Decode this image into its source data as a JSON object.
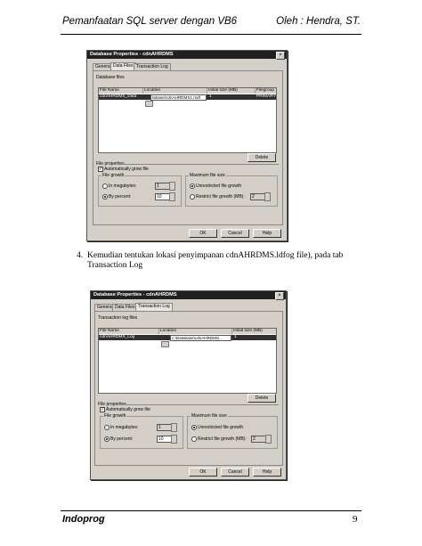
{
  "header": {
    "left": "Pemanfaatan SQL server dengan VB6",
    "right": "Oleh : Hendra, ST."
  },
  "footer": {
    "left": "Indoprog",
    "page": "9"
  },
  "paragraph": {
    "number": "4.",
    "text": "Kemudian tentukan lokasi penyimpanan cdnAHRDMS.ldfog file), pada tab Transaction Log"
  },
  "dialog1": {
    "title": "Database Properties - cdnAHRDMS",
    "close": "×",
    "tabs": [
      "General",
      "Data Files",
      "Transaction Log"
    ],
    "list_label": "Database files",
    "columns": [
      "File Name",
      "Location",
      "Initial size (MB)",
      "Filegroup"
    ],
    "row": {
      "name": "cdnAHRDMS_Data",
      "location": "tabase\\cdnAHRDMS1.mdf",
      "size": "1",
      "group": "PRIMARY"
    },
    "delete": "Delete",
    "file_properties": "File properties",
    "auto_grow": "Automatically grow file",
    "file_growth": "File growth",
    "in_megabytes": "In megabytes:",
    "megabytes_value": "1",
    "by_percent": "By percent:",
    "percent_value": "10",
    "max_size": "Maximum file size",
    "unrestricted": "Unrestricted file growth",
    "restrict": "Restrict file growth (MB):",
    "restrict_value": "2",
    "ok": "OK",
    "cancel": "Cancel",
    "help": "Help"
  },
  "dialog2": {
    "title": "Database Properties - cdnAHRDMS",
    "close": "×",
    "tabs": [
      "General",
      "Data Files",
      "Transaction Log"
    ],
    "list_label": "Transaction log files",
    "columns": [
      "File Name",
      "Location",
      "Initial size (MB)"
    ],
    "row": {
      "name": "cdnAHRDMS_Log",
      "location": "c:\\Database\\cdnAHRDMS...",
      "size": "1"
    },
    "delete": "Delete",
    "file_properties": "File properties",
    "auto_grow": "Automatically grow file",
    "file_growth": "File growth",
    "in_megabytes": "In megabytes:",
    "megabytes_value": "1",
    "by_percent": "By percent:",
    "percent_value": "10",
    "max_size": "Maximum file size",
    "unrestricted": "Unrestricted file growth",
    "restrict": "Restrict file growth (MB):",
    "restrict_value": "2",
    "ok": "OK",
    "cancel": "Cancel",
    "help": "Help"
  }
}
